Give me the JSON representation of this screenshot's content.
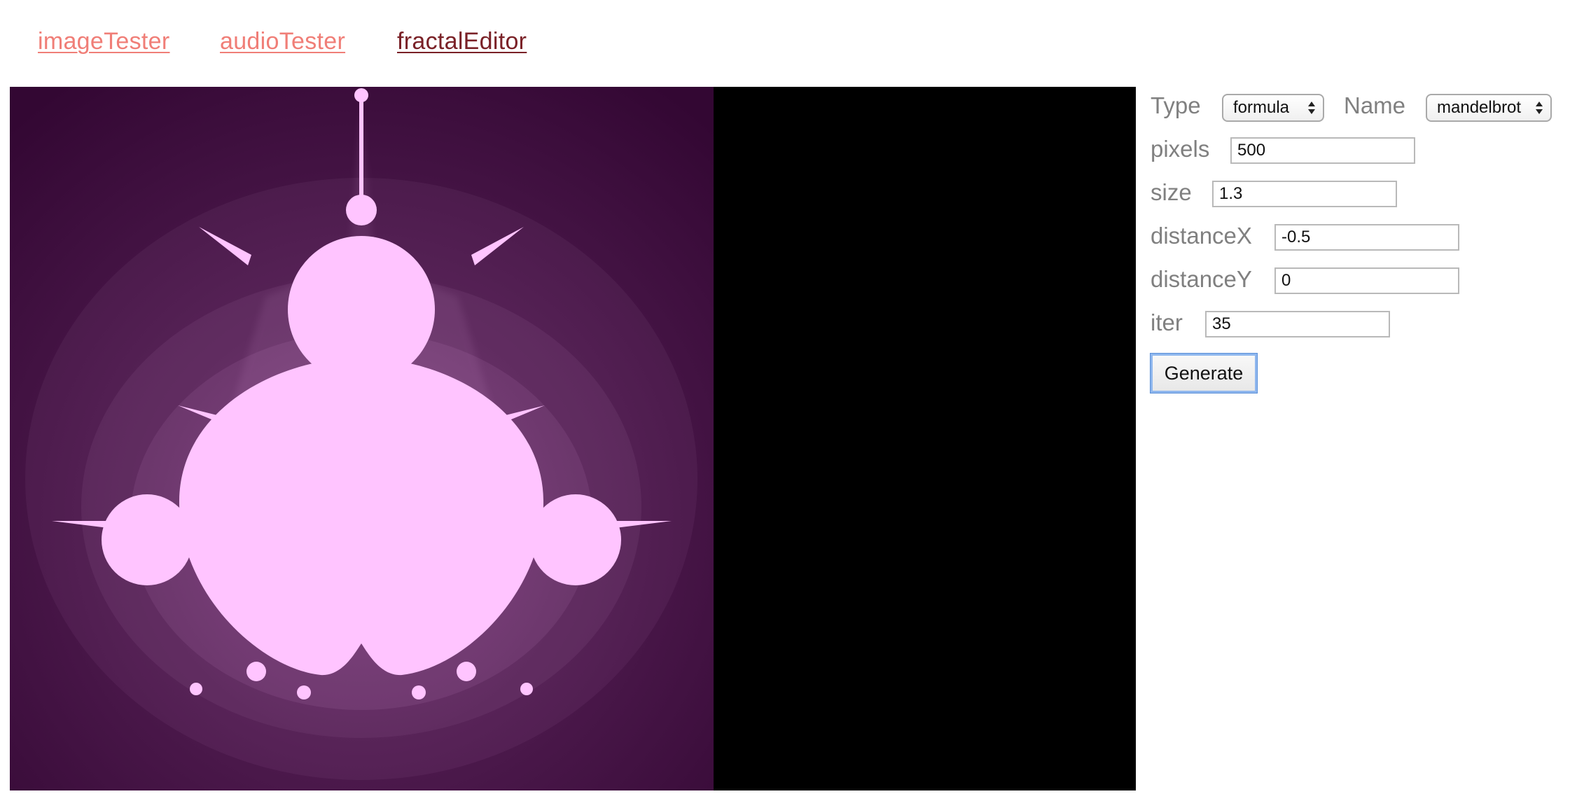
{
  "nav": {
    "links": [
      {
        "label": "imageTester"
      },
      {
        "label": "audioTester"
      },
      {
        "label": "fractalEditor"
      }
    ]
  },
  "canvas": {
    "background_color": "#3a0b3a",
    "fractal_color": "#ffc4ff",
    "empty_color": "#000000",
    "rendered_fraction": 0.625
  },
  "form": {
    "type_label": "Type",
    "type_value": "formula",
    "name_label": "Name",
    "name_value": "mandelbrot",
    "pixels_label": "pixels",
    "pixels_value": "500",
    "size_label": "size",
    "size_value": "1.3",
    "distanceX_label": "distanceX",
    "distanceX_value": "-0.5",
    "distanceY_label": "distanceY",
    "distanceY_value": "0",
    "iter_label": "iter",
    "iter_value": "35",
    "generate_label": "Generate"
  },
  "colors": {
    "nav_link": "#f07e77",
    "nav_active": "#7a2127",
    "label_gray": "#808080",
    "focus_blue": "#8fb7ee"
  }
}
